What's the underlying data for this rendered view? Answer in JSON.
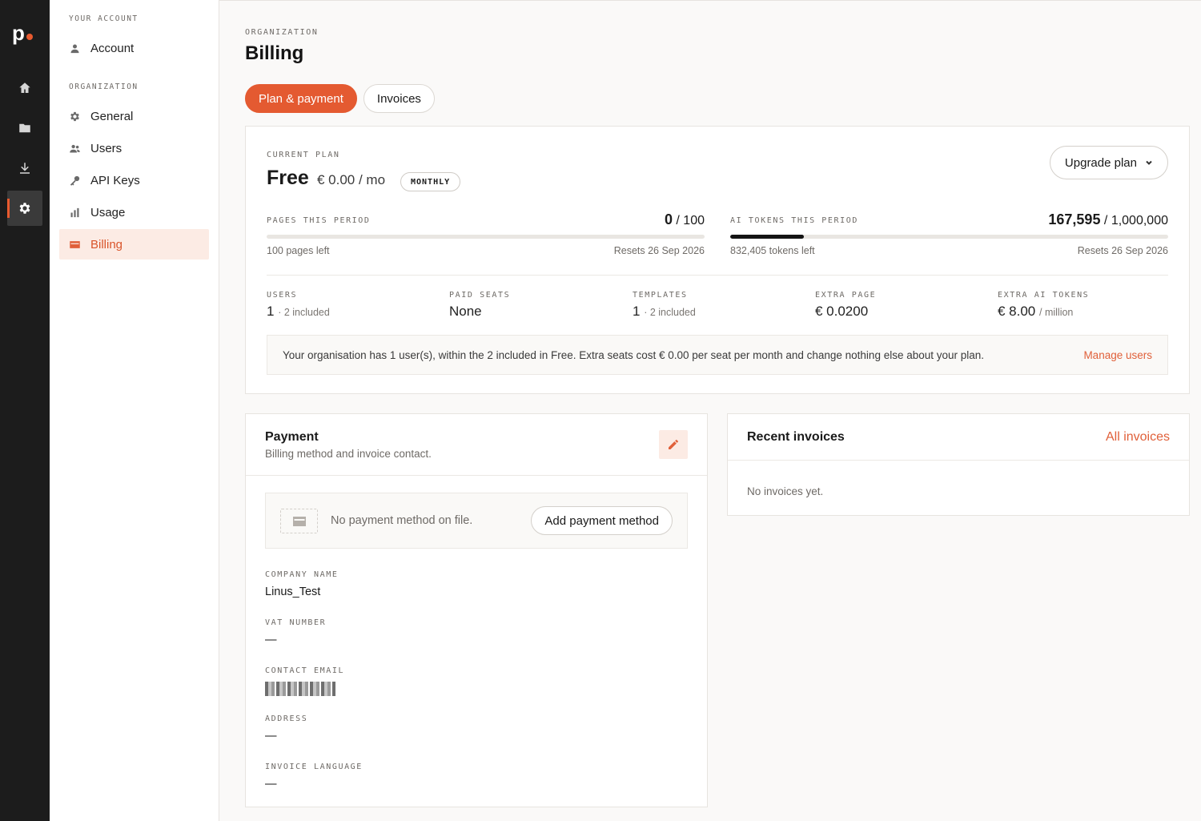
{
  "rail": {
    "logo": "p",
    "items": [
      {
        "name": "home-icon"
      },
      {
        "name": "folder-icon"
      },
      {
        "name": "download-icon"
      },
      {
        "name": "settings-icon",
        "active": true
      }
    ]
  },
  "sidebar": {
    "account_section": "YOUR ACCOUNT",
    "account_item": "Account",
    "org_section": "ORGANIZATION",
    "items": [
      {
        "label": "General",
        "icon": "gear-icon"
      },
      {
        "label": "Users",
        "icon": "users-icon"
      },
      {
        "label": "API Keys",
        "icon": "key-icon"
      },
      {
        "label": "Usage",
        "icon": "bar-chart-icon"
      },
      {
        "label": "Billing",
        "icon": "credit-card-icon",
        "active": true
      }
    ]
  },
  "header": {
    "eyebrow": "ORGANIZATION",
    "title": "Billing",
    "tabs": [
      {
        "label": "Plan & payment",
        "active": true
      },
      {
        "label": "Invoices",
        "active": false
      }
    ]
  },
  "plan": {
    "current_label": "CURRENT PLAN",
    "name": "Free",
    "price": "€ 0.00 / mo",
    "badge": "MONTHLY",
    "upgrade_label": "Upgrade plan",
    "pages": {
      "label": "PAGES THIS PERIOD",
      "used": "0",
      "limit": "/ 100",
      "fraction": 0,
      "left": "100 pages left",
      "reset": "Resets 26 Sep 2026"
    },
    "tokens": {
      "label": "AI TOKENS THIS PERIOD",
      "used": "167,595",
      "limit": "/ 1,000,000",
      "fraction": 0.1676,
      "left": "832,405 tokens left",
      "reset": "Resets 26 Sep 2026"
    },
    "stats": [
      {
        "label": "USERS",
        "value": "1",
        "note": "· 2 included"
      },
      {
        "label": "PAID SEATS",
        "value": "None",
        "note": ""
      },
      {
        "label": "TEMPLATES",
        "value": "1",
        "note": "· 2 included"
      },
      {
        "label": "EXTRA PAGE",
        "value": "€ 0.0200",
        "note": ""
      },
      {
        "label": "EXTRA AI TOKENS",
        "value": "€ 8.00",
        "note": "/ million"
      }
    ],
    "notice": "Your organisation has 1 user(s), within the 2 included in Free. Extra seats cost € 0.00 per seat per month and change nothing else about your plan.",
    "notice_link": "Manage users"
  },
  "payment": {
    "title": "Payment",
    "subtitle": "Billing method and invoice contact.",
    "empty_text": "No payment method on file.",
    "add_label": "Add payment method",
    "fields": [
      {
        "label": "COMPANY NAME",
        "value": "Linus_Test"
      },
      {
        "label": "VAT NUMBER",
        "value": "—"
      },
      {
        "label": "CONTACT EMAIL",
        "value": ""
      },
      {
        "label": "ADDRESS",
        "value": "—"
      },
      {
        "label": "INVOICE LANGUAGE",
        "value": "—"
      }
    ]
  },
  "invoices": {
    "title": "Recent invoices",
    "all_label": "All invoices",
    "empty_text": "No invoices yet."
  },
  "colors": {
    "accent": "#e45a31",
    "rail_bg": "#1c1c1c",
    "active_bg": "#fcebe4"
  }
}
